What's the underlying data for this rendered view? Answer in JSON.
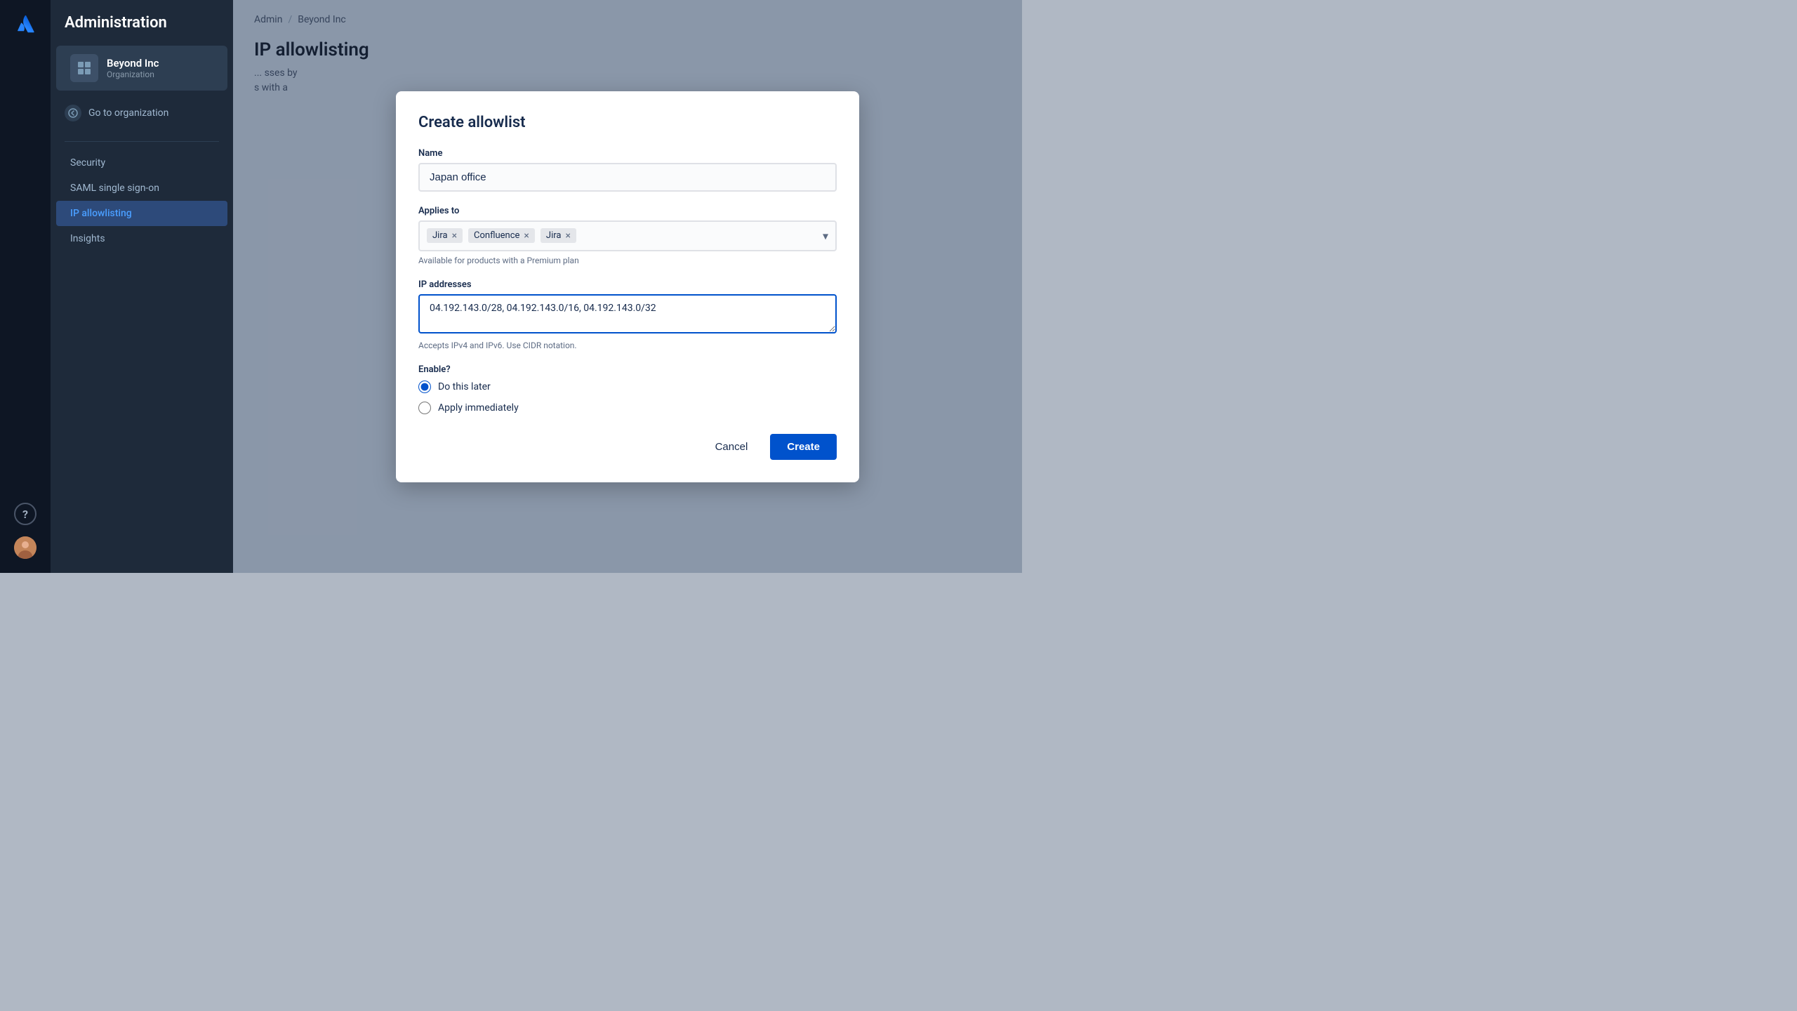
{
  "iconSidebar": {
    "helpLabel": "?",
    "avatarAlt": "User avatar"
  },
  "navPanel": {
    "adminTitle": "Administration",
    "orgCard": {
      "iconSymbol": "▦",
      "orgName": "Beyond Inc",
      "orgType": "Organization"
    },
    "goToOrgLabel": "Go to organization",
    "navItems": [
      {
        "id": "security",
        "label": "Security",
        "active": false
      },
      {
        "id": "saml",
        "label": "SAML single sign-on",
        "active": false
      },
      {
        "id": "ip-allowlisting",
        "label": "IP allowlisting",
        "active": true
      },
      {
        "id": "insights",
        "label": "Insights",
        "active": false
      }
    ]
  },
  "breadcrumb": {
    "admin": "Admin",
    "separator": "/",
    "org": "Beyond Inc"
  },
  "pageTitle": "IP allowlisting",
  "pageDescription": {
    "part1": "sses by",
    "part2": "s with a"
  },
  "modal": {
    "title": "Create allowlist",
    "nameLabel": "Name",
    "namePlaceholder": "",
    "nameValue": "Japan office",
    "appliesToLabel": "Applies to",
    "tags": [
      {
        "id": "jira1",
        "label": "Jira"
      },
      {
        "id": "confluence",
        "label": "Confluence"
      },
      {
        "id": "jira2",
        "label": "Jira"
      }
    ],
    "premiumHint": "Available for products with a Premium plan",
    "ipAddressesLabel": "IP addresses",
    "ipAddressesValue": "04.192.143.0/28, 04.192.143.0/16, 04.192.143.0/32",
    "ipHint": "Accepts IPv4 and IPv6. Use CIDR notation.",
    "enableLabel": "Enable?",
    "radioOptions": [
      {
        "id": "later",
        "label": "Do this later",
        "checked": true
      },
      {
        "id": "immediately",
        "label": "Apply immediately",
        "checked": false
      }
    ],
    "cancelLabel": "Cancel",
    "createLabel": "Create"
  }
}
